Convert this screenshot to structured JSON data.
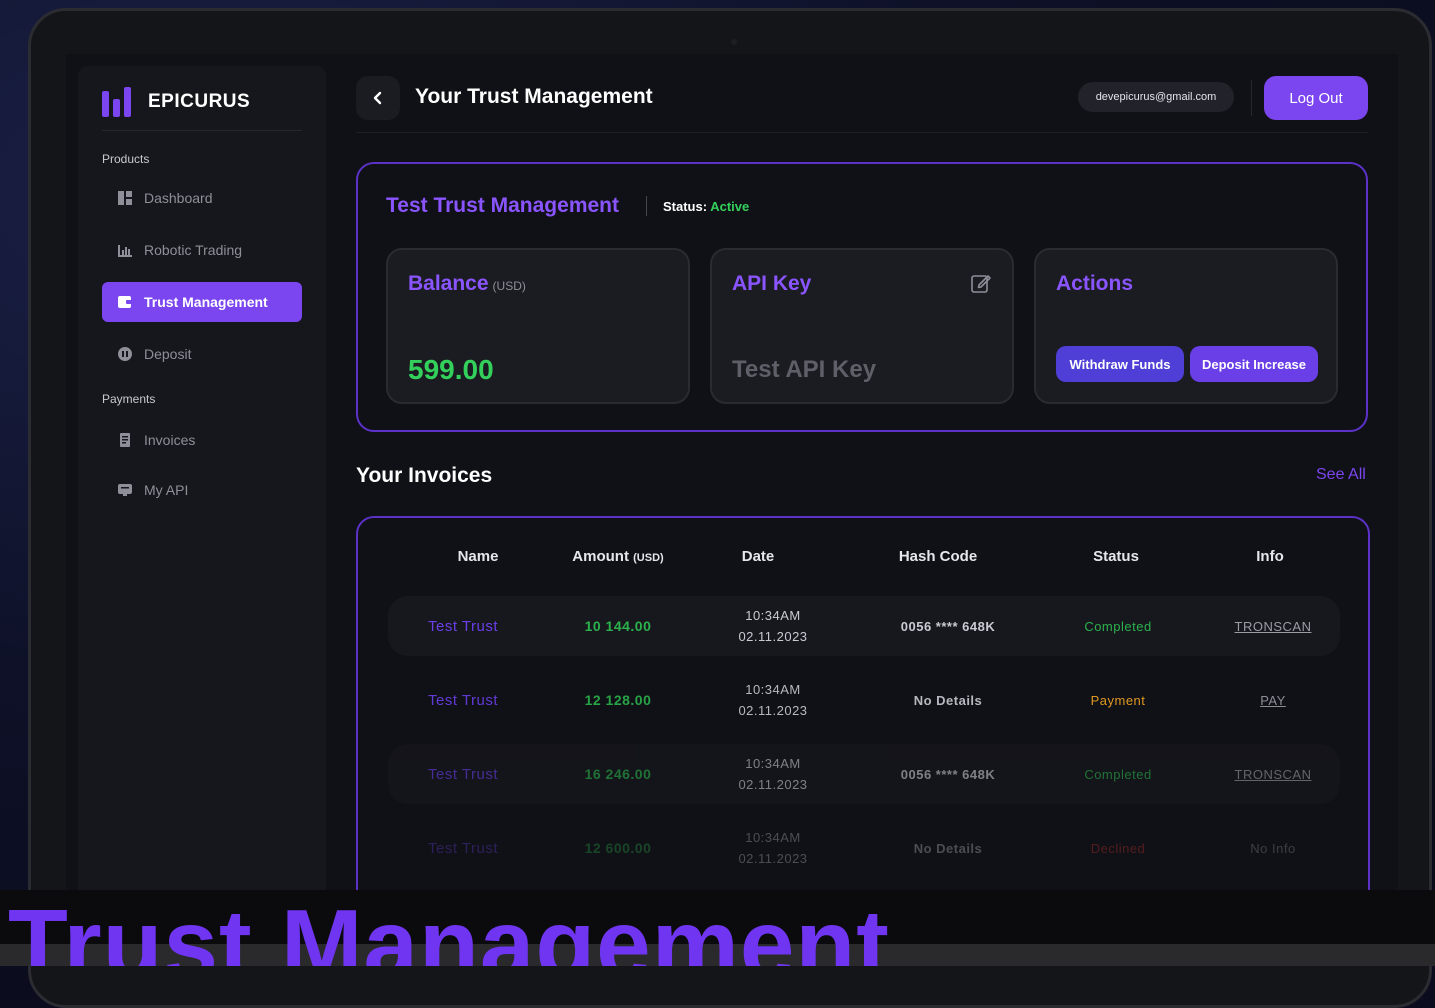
{
  "brand": {
    "name": "EPICURUS"
  },
  "sidebar": {
    "sections": [
      {
        "label": "Products"
      },
      {
        "label": "Payments"
      }
    ],
    "items": [
      {
        "label": "Dashboard",
        "icon": "dashboard-icon"
      },
      {
        "label": "Robotic Trading",
        "icon": "chart-icon"
      },
      {
        "label": "Trust Management",
        "icon": "wallet-icon",
        "active": true
      },
      {
        "label": "Deposit",
        "icon": "deposit-icon"
      },
      {
        "label": "Invoices",
        "icon": "invoice-icon"
      },
      {
        "label": "My API",
        "icon": "api-icon"
      }
    ]
  },
  "header": {
    "title": "Your Trust Management",
    "back_icon": "chevron-left-icon",
    "email": "devepicurus@gmail.com",
    "logout_label": "Log Out"
  },
  "trust": {
    "title": "Test Trust Management",
    "status_label": "Status:",
    "status_value": "Active",
    "balance": {
      "title": "Balance",
      "unit": "(USD)",
      "value": "599.00"
    },
    "api_key": {
      "title": "API Key",
      "value": "Test API Key",
      "icon": "edit-icon"
    },
    "actions": {
      "title": "Actions",
      "withdraw_label": "Withdraw Funds",
      "deposit_label": "Deposit Increase"
    }
  },
  "invoices": {
    "title": "Your Invoices",
    "see_all_label": "See All",
    "columns": {
      "name": "Name",
      "amount": "Amount",
      "amount_unit": "(USD)",
      "date": "Date",
      "hash": "Hash Code",
      "status": "Status",
      "info": "Info"
    },
    "rows": [
      {
        "name": "Test Trust",
        "amount": "10 144.00",
        "time": "10:34AM",
        "date": "02.11.2023",
        "hash": "0056 **** 648K",
        "status": "Completed",
        "info": "TRONSCAN"
      },
      {
        "name": "Test Trust",
        "amount": "12 128.00",
        "time": "10:34AM",
        "date": "02.11.2023",
        "hash": "No Details",
        "status": "Payment",
        "info": "PAY"
      },
      {
        "name": "Test Trust",
        "amount": "16 246.00",
        "time": "10:34AM",
        "date": "02.11.2023",
        "hash": "0056 **** 648K",
        "status": "Completed",
        "info": "TRONSCAN"
      },
      {
        "name": "Test Trust",
        "amount": "12 600.00",
        "time": "10:34AM",
        "date": "02.11.2023",
        "hash": "No Details",
        "status": "Declined",
        "info": "No Info"
      }
    ]
  },
  "colors": {
    "accent": "#7b45f0",
    "success": "#33d15c",
    "warning": "#f5a623",
    "danger": "#e0342f"
  },
  "caption": "Trust Management"
}
